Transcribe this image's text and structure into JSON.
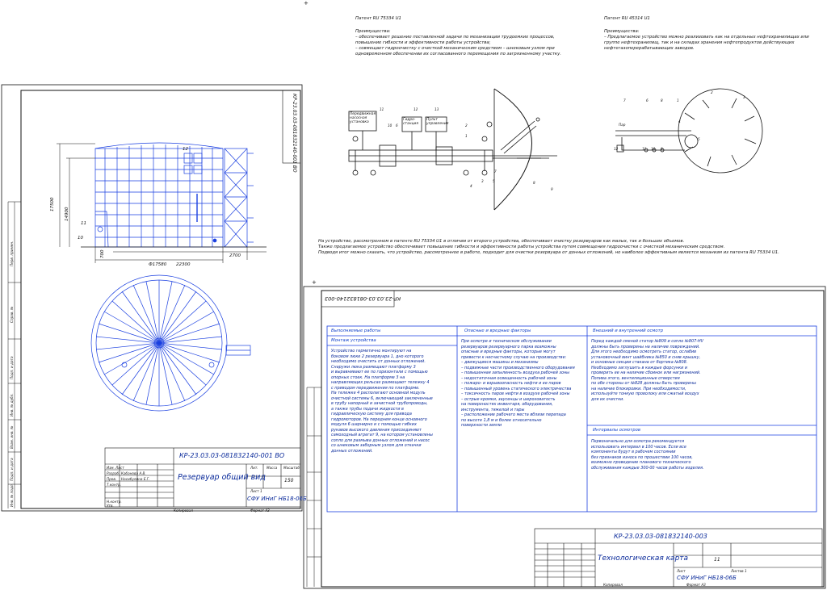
{
  "patent1": {
    "title": "Патент RU 75334 U1",
    "adv_head": "Преимущества:",
    "adv_lines": [
      "– обеспечивает решение поставленной задачи по механизации трудоемких процессов,",
      "повышение гибкости и эффективности работы устройства;",
      "– совмещает гидроочистку с очисткой механическим средством – шнековым узлом при",
      "одновременном обеспечении их согласованного перемещения по загрязненному участку."
    ]
  },
  "patent2": {
    "title": "Патент RU 45314 U1",
    "adv_head": "Преимущества:",
    "adv_lines": [
      "– Предлагаемое устройство можно реализовать как на отдельных нефтехранилищах или",
      "группе нефтехранилищ, так и на складах хранения нефтепродуктов действующих",
      "нефтегазоперерабатывающих заводов."
    ]
  },
  "fig1_labels": {
    "box1": "Передвижная\nнасосная\nустановка",
    "box2": "Гидро-\nстанция",
    "box3": "Пульт\nуправления",
    "n1": "1",
    "n2": "2",
    "n3": "3",
    "n4": "4",
    "n5": "5",
    "n6": "6",
    "n7": "7",
    "n8": "8",
    "n9": "9",
    "n10": "10",
    "n11": "11",
    "n12": "12",
    "n13": "13"
  },
  "fig2_labels": {
    "par": "Пар",
    "n1": "1",
    "n2": "2",
    "n3": "3",
    "n4": "4",
    "n5": "5",
    "n6": "6",
    "n7": "7",
    "n8": "8",
    "n9": "9",
    "n10": "10",
    "n11": "11",
    "n12": "12"
  },
  "comparison_lines": [
    "На устройстве, рассмотренном в патенте RU 75334 U1 в отличии от второго устройства, обеспечивает очистку резервуаров как малых, так и больших объемов.",
    "Также предлагаемое устройство обеспечивает повышение гибкости и эффективности работы устройства путем совмещения гидроочистки с очисткой механическим средством.",
    "Подводя итог можно сказать, что устройство, рассмотренное в работе, подходит для очистки резервуара от донных отложений, но наиболее эффективным является механизм из патента RU 75334 U1."
  ],
  "sheet1": {
    "code_rot": "КР-23.03.03-081832140-001 ВО",
    "dim_17500": "17500",
    "dim_14900": "14900",
    "dim_22300": "22300",
    "dim_d17580": "Ф17580",
    "dim_2700": "2700",
    "dim_700": "700",
    "lbl_10": "10",
    "lbl_11": "11",
    "lbl_12": "12",
    "stamp_code": "КР-23.03.03-081832140-001 ВО",
    "stamp_title": "Резервуар общий вид",
    "stamp_mass": "150",
    "stamp_org": "СФУ ИНиГ НБ18-06Б",
    "stamp_sheet": "Лист 1",
    "stamp_lit": "Лит.",
    "stamp_massa_h": "Масса",
    "stamp_scale_h": "Масштаб",
    "copied": "Копировал",
    "format": "Формат   А3",
    "side_labels": [
      "Перв. примен.",
      "Справ. №",
      "Подп. и дата",
      "Инв. № дубл.",
      "Взам. инв. №",
      "Подп. и дата",
      "Инв. № подл."
    ],
    "stamp_rows": [
      "Изм. Лист",
      "Разраб.",
      "Пров.",
      "Т.контр.",
      "Н.контр.",
      "Утв."
    ],
    "stamp_names": [
      "Кабанова А.В.",
      "Насибулина Е.Г."
    ]
  },
  "sheet2": {
    "code_rot": "КР-23.03.03-081832140-003",
    "col1_head": "Выполняемые работы",
    "col2_head": "Опасные и вредные факторы",
    "col3_head": "Внешний и внутренний осмотр",
    "col1_sub": "Монтаж устройства",
    "col1_text": "Устройство герметично монтируют на\nбоковом люке 2 резервуара 1, дно которого\nнеобходимо очистить от донных отложений.\nСнаружи люка размещают платформу 3\nи выравнивают ее по горизонтали с помощью\nопорных стоек. На платформе 3 на\nнаправляющих рельсах размещают тележку 4\nс приводом передвижения по платформе.\nНа тележке 4 располагают основной модуль\nочистной системы 6, включающий заключенные\nв трубу напорный и зачистной трубопроводы,\nа также трубы подачи жидкости в\nгидравлическую систему для привода\nгидромоторов. На переднем конце основного\nмодуля 6 шарнирно и с помощью гибких\nрукавов высокого давления присоединяют\nсамоходный агрегат 9, на котором установлены\nсопло для размыва донных отложений и насос\nсо шнековым заборным узлом для откачки\nдонных отложений.",
    "col2_text": "При осмотре и техническом обслуживании\nрезервуаров резервуарного парка возможны\nопасные и вредные факторы, которые могут\nпривести к несчастному случаю на производстве:\n– движущиеся машины и механизмы\n– подвижные части производственного оборудования\n– повышенная запыленность воздуха рабочей зоны\n– недостаточная освещенность рабочей зоны\n– пожаро- и взрывоопасность нефти и ее паров\n– повышенный уровень статического электричества\n– токсичность паров нефти в воздухе рабочей зоны\n– острые кромки, заусенцы и шероховатость\nна поверхностях инвентаря, оборудования,\nинструмента, тяжелой и тары\n– расположение рабочего места вблизи перепада\nпо высоте 1,8 м и более относительно\nповерхности земли",
    "col3_text": "Перед каждой сменой статор №809 и сопло №807-HV\nдолжны быть проверены на наличие повреждений.\nДля этого необходимо осмотреть статор, ослабив\nустановочный винт шайбника №850 и сняв крышку,\nи основные секции стакана от бортика №808.\nНеобходимо заглушить в каждые форсунки и\nпроверить ее на наличие сбоинок или нагрязнений.\nПопива этого, вентиляционные отверстия\nпо обе стороны от №828 должны быть проверены\nна наличие блокировки. При необходимости,\nиспользуйте тонкую проволоку или сжатый воздух\nдля их очистки.",
    "col3_sub": "Интервалы осмотров",
    "col3_text2": "Первоначально для осмотра рекомендуется\nиспользовать интервал в 100 часов. Если все\nкомпоненты будут в рабочем состоянии\nбез признаков износа по прошествии 100 часов,\nвозможно проведение планового технического\nобслуживания каждые 300-00 часов работы изделия.",
    "stamp_code": "КР-23.03.03-081832140-003",
    "stamp_title": "Технологическая карта",
    "stamp_mass": "11",
    "stamp_org": "СФУ ИНиГ НБ18-06Б",
    "stamp_sheet": "Лист",
    "stamp_sheets": "Листов  1",
    "copied": "Копировал",
    "format": "Формат   А3"
  }
}
